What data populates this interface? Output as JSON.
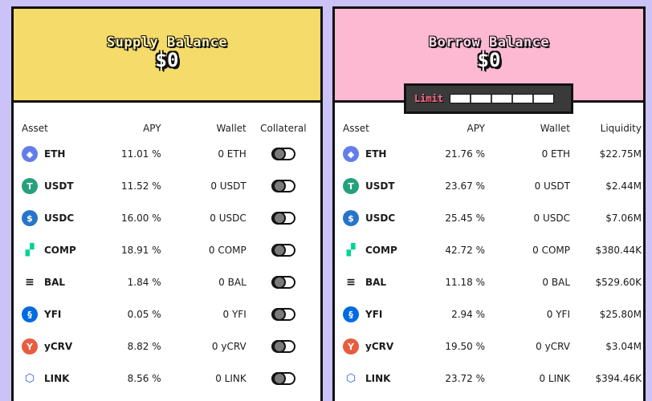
{
  "supply": {
    "title": "Supply Balance",
    "amount": "$0",
    "headers": {
      "asset": "Asset",
      "apy": "APY",
      "wallet": "Wallet",
      "last": "Collateral"
    },
    "rows": [
      {
        "symbol": "ETH",
        "apy": "11.01 %",
        "wallet": "0 ETH",
        "collateral_enabled": false
      },
      {
        "symbol": "USDT",
        "apy": "11.52 %",
        "wallet": "0 USDT",
        "collateral_enabled": false
      },
      {
        "symbol": "USDC",
        "apy": "16.00 %",
        "wallet": "0 USDC",
        "collateral_enabled": false
      },
      {
        "symbol": "COMP",
        "apy": "18.91 %",
        "wallet": "0 COMP",
        "collateral_enabled": false
      },
      {
        "symbol": "BAL",
        "apy": "1.84 %",
        "wallet": "0 BAL",
        "collateral_enabled": false
      },
      {
        "symbol": "YFI",
        "apy": "0.05 %",
        "wallet": "0 YFI",
        "collateral_enabled": false
      },
      {
        "symbol": "yCRV",
        "apy": "8.82 %",
        "wallet": "0 yCRV",
        "collateral_enabled": false
      },
      {
        "symbol": "LINK",
        "apy": "8.56 %",
        "wallet": "0 LINK",
        "collateral_enabled": false
      }
    ]
  },
  "borrow": {
    "title": "Borrow Balance",
    "amount": "$0",
    "limit_label": "Limit",
    "limit_used_fraction": 0,
    "headers": {
      "asset": "Asset",
      "apy": "APY",
      "wallet": "Wallet",
      "last": "Liquidity"
    },
    "rows": [
      {
        "symbol": "ETH",
        "apy": "21.76 %",
        "wallet": "0 ETH",
        "liquidity": "$22.75M"
      },
      {
        "symbol": "USDT",
        "apy": "23.67 %",
        "wallet": "0 USDT",
        "liquidity": "$2.44M"
      },
      {
        "symbol": "USDC",
        "apy": "25.45 %",
        "wallet": "0 USDC",
        "liquidity": "$7.06M"
      },
      {
        "symbol": "COMP",
        "apy": "42.72 %",
        "wallet": "0 COMP",
        "liquidity": "$380.44K"
      },
      {
        "symbol": "BAL",
        "apy": "11.18 %",
        "wallet": "0 BAL",
        "liquidity": "$529.60K"
      },
      {
        "symbol": "YFI",
        "apy": "2.94 %",
        "wallet": "0 YFI",
        "liquidity": "$25.80M"
      },
      {
        "symbol": "yCRV",
        "apy": "19.50 %",
        "wallet": "0 yCRV",
        "liquidity": "$3.04M"
      },
      {
        "symbol": "LINK",
        "apy": "23.72 %",
        "wallet": "0 LINK",
        "liquidity": "$394.46K"
      }
    ]
  },
  "icons": [
    {
      "name": "eth-icon",
      "glyph": "◆",
      "bg": "#627eea"
    },
    {
      "name": "usdt-icon",
      "glyph": "T",
      "bg": "#26a17b"
    },
    {
      "name": "usdc-icon",
      "glyph": "$",
      "bg": "#2775ca"
    },
    {
      "name": "comp-icon",
      "glyph": "▞",
      "bg": "#ffffff"
    },
    {
      "name": "bal-icon",
      "glyph": "≡",
      "bg": "#ffffff"
    },
    {
      "name": "yfi-icon",
      "glyph": "§",
      "bg": "#006ae3"
    },
    {
      "name": "ycrv-icon",
      "glyph": "Y",
      "bg": "#e85d3f"
    },
    {
      "name": "link-icon",
      "glyph": "⬡",
      "bg": "#ffffff"
    }
  ],
  "colors": {
    "background": "#cbc3f7",
    "supply_header": "#f5db6a",
    "borrow_header": "#fdb8d2",
    "toggle_knob": "#7a7a7a",
    "limit_text": "#ff6b8a"
  }
}
